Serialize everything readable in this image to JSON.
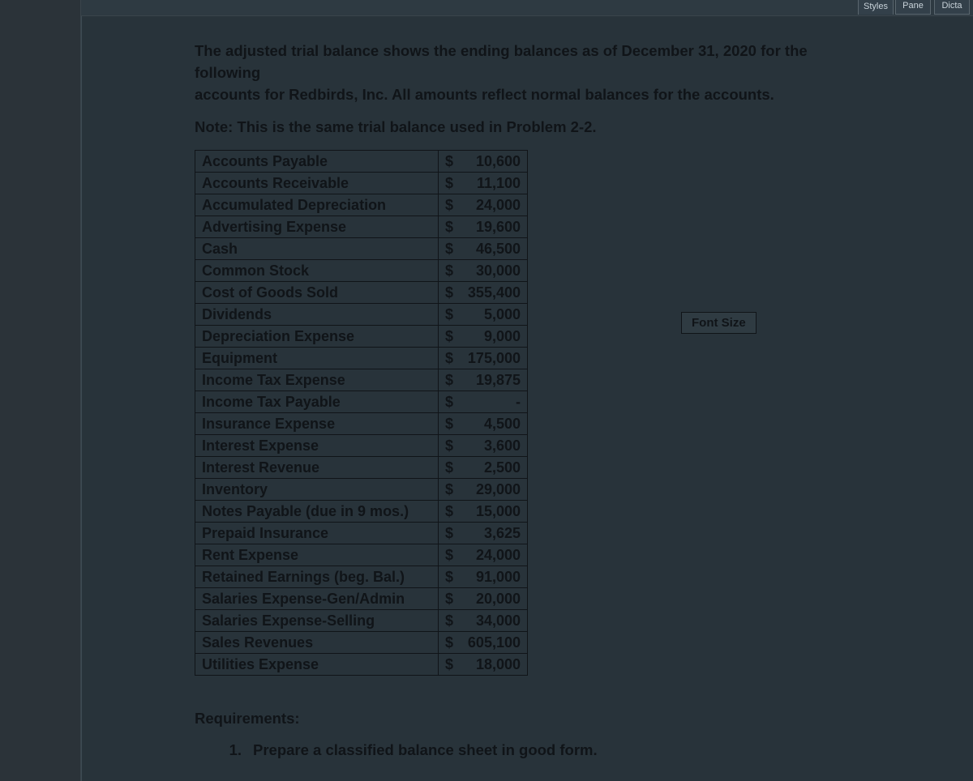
{
  "topbar": {
    "styles": "Styles",
    "pane": "Pane",
    "dict": "Dicta"
  },
  "intro": {
    "line1": "The adjusted trial balance shows the ending balances as of December 31, 2020 for the following",
    "line2": "accounts for Redbirds, Inc.  All amounts reflect normal balances for the accounts.",
    "note": "Note: This is the same trial balance used in Problem 2-2."
  },
  "rows": [
    {
      "name": "Accounts Payable",
      "amount": "10,600"
    },
    {
      "name": "Accounts Receivable",
      "amount": "11,100"
    },
    {
      "name": "Accumulated Depreciation",
      "amount": "24,000"
    },
    {
      "name": "Advertising Expense",
      "amount": "19,600"
    },
    {
      "name": "Cash",
      "amount": "46,500"
    },
    {
      "name": "Common Stock",
      "amount": "30,000"
    },
    {
      "name": "Cost of Goods Sold",
      "amount": "355,400"
    },
    {
      "name": "Dividends",
      "amount": "5,000"
    },
    {
      "name": "Depreciation Expense",
      "amount": "9,000"
    },
    {
      "name": "Equipment",
      "amount": "175,000"
    },
    {
      "name": "Income Tax Expense",
      "amount": "19,875"
    },
    {
      "name": "Income Tax Payable",
      "amount": "-"
    },
    {
      "name": "Insurance Expense",
      "amount": "4,500"
    },
    {
      "name": "Interest Expense",
      "amount": "3,600"
    },
    {
      "name": "Interest Revenue",
      "amount": "2,500"
    },
    {
      "name": "Inventory",
      "amount": "29,000"
    },
    {
      "name": "Notes Payable (due in 9 mos.)",
      "amount": "15,000"
    },
    {
      "name": "Prepaid Insurance",
      "amount": "3,625"
    },
    {
      "name": "Rent Expense",
      "amount": "24,000"
    },
    {
      "name": "Retained Earnings (beg. Bal.)",
      "amount": "91,000"
    },
    {
      "name": "Salaries Expense-Gen/Admin",
      "amount": "20,000"
    },
    {
      "name": "Salaries Expense-Selling",
      "amount": "34,000"
    },
    {
      "name": "Sales Revenues",
      "amount": "605,100"
    },
    {
      "name": "Utilities Expense",
      "amount": "18,000"
    }
  ],
  "currency_symbol": "$",
  "fontsize_label": "Font Size",
  "requirements": {
    "heading": "Requirements:",
    "items": [
      {
        "n": "1.",
        "text": "Prepare a classified balance sheet in good form."
      }
    ]
  }
}
